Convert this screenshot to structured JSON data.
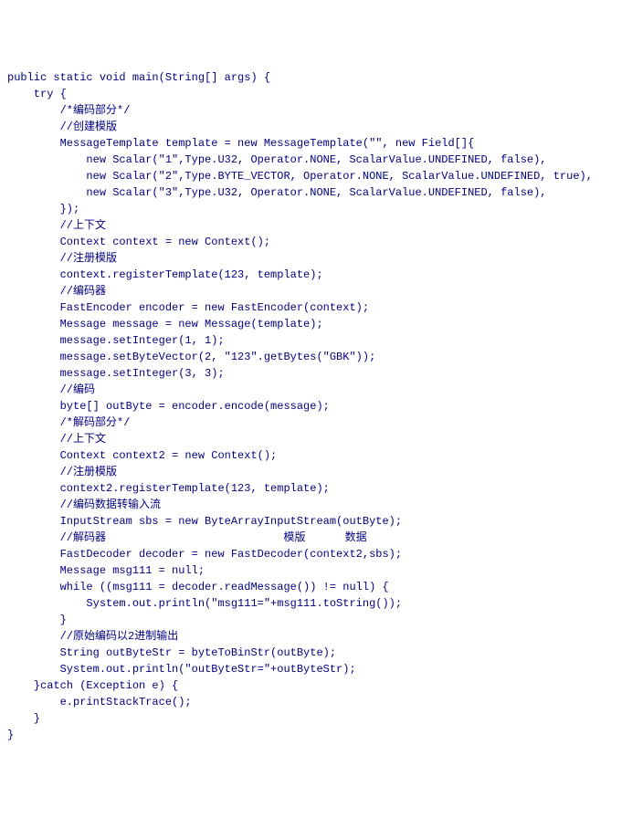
{
  "code": {
    "lines": [
      "public static void main(String[] args) {",
      "    try {",
      "        /*编码部分*/",
      "        //创建模版",
      "        MessageTemplate template = new MessageTemplate(\"\", new Field[]{",
      "            new Scalar(\"1\",Type.U32, Operator.NONE, ScalarValue.UNDEFINED, false),",
      "            new Scalar(\"2\",Type.BYTE_VECTOR, Operator.NONE, ScalarValue.UNDEFINED, true),",
      "            new Scalar(\"3\",Type.U32, Operator.NONE, ScalarValue.UNDEFINED, false),",
      "        });",
      "        //上下文",
      "        Context context = new Context();",
      "        //注册模版",
      "        context.registerTemplate(123, template);",
      "        //编码器",
      "        FastEncoder encoder = new FastEncoder(context);",
      "        Message message = new Message(template);",
      "        message.setInteger(1, 1);",
      "        message.setByteVector(2, \"123\".getBytes(\"GBK\"));",
      "        message.setInteger(3, 3);",
      "        //编码",
      "        byte[] outByte = encoder.encode(message);",
      "",
      "        /*解码部分*/",
      "        //上下文",
      "        Context context2 = new Context();",
      "        //注册模版",
      "        context2.registerTemplate(123, template);",
      "        //编码数据转输入流",
      "        InputStream sbs = new ByteArrayInputStream(outByte);",
      "        //解码器                           模版      数据",
      "        FastDecoder decoder = new FastDecoder(context2,sbs);",
      "        Message msg111 = null;",
      "        while ((msg111 = decoder.readMessage()) != null) {",
      "            System.out.println(\"msg111=\"+msg111.toString());",
      "        }",
      "        //原始编码以2进制输出",
      "        String outByteStr = byteToBinStr(outByte);",
      "        System.out.println(\"outByteStr=\"+outByteStr);",
      "",
      "    }catch (Exception e) {",
      "        e.printStackTrace();",
      "    }",
      "}"
    ]
  }
}
